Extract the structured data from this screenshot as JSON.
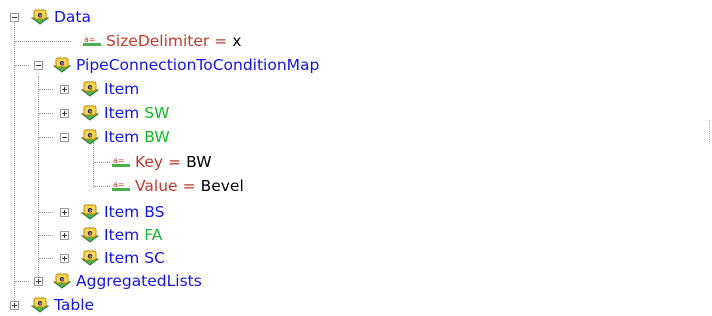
{
  "tree": {
    "data": {
      "label": "Data"
    },
    "size_delimiter": {
      "name": "SizeDelimiter",
      "eq": "=",
      "value": "x"
    },
    "pipe_map": {
      "label": "PipeConnectionToConditionMap"
    },
    "items": [
      {
        "label": "Item",
        "suffix": ""
      },
      {
        "label": "Item",
        "suffix": "SW"
      },
      {
        "label": "Item",
        "suffix": "BW"
      },
      {
        "label": "Item",
        "suffix": "BS"
      },
      {
        "label": "Item",
        "suffix": "FA"
      },
      {
        "label": "Item",
        "suffix": "SC"
      }
    ],
    "bw_attrs": [
      {
        "name": "Key",
        "eq": "=",
        "value": "BW"
      },
      {
        "name": "Value",
        "eq": "=",
        "value": "Bevel"
      }
    ],
    "aggregated": {
      "label": "AggregatedLists"
    },
    "table": {
      "label": "Table"
    }
  },
  "colors": {
    "element": "#1414e6",
    "attribute": "#c0392b",
    "green_suffix": "#15b82a"
  },
  "icons": {
    "element": "xml-element-icon",
    "attribute": "xml-attribute-icon",
    "expander": "tree-expander-icon"
  }
}
